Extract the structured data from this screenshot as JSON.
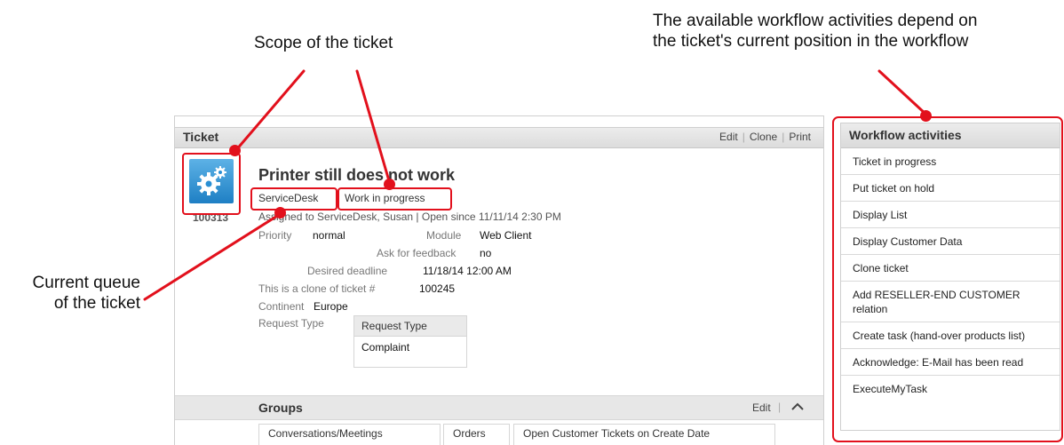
{
  "annotations": {
    "scope": "Scope of the ticket",
    "workflow_line1": "The available workflow activities depend on",
    "workflow_line2": "the ticket's current position in the workflow",
    "queue_line1": "Current queue",
    "queue_line2": "of the ticket"
  },
  "ticket": {
    "header_title": "Ticket",
    "actions": {
      "edit": "Edit",
      "clone": "Clone",
      "print": "Print"
    },
    "number": "100313",
    "title": "Printer still does not work",
    "queue": "ServiceDesk",
    "status": "Work in progress",
    "assigned": "Assigned to ServiceDesk, Susan | Open since 11/11/14 2:30 PM",
    "fields": {
      "priority_label": "Priority",
      "priority_value": "normal",
      "module_label": "Module",
      "module_value": "Web Client",
      "feedback_label": "Ask for feedback",
      "feedback_value": "no",
      "deadline_label": "Desired deadline",
      "deadline_value": "11/18/14 12:00 AM",
      "clone_label": "This is a clone of ticket #",
      "clone_value": "100245",
      "continent_label": "Continent",
      "continent_value": "Europe",
      "request_type_label": "Request Type"
    },
    "request_type_table": {
      "header": "Request Type",
      "value": "Complaint"
    },
    "icon": "gears-icon"
  },
  "groups": {
    "title": "Groups",
    "edit": "Edit",
    "tabs": [
      "Conversations/Meetings",
      "Orders",
      "Open Customer Tickets on Create Date"
    ]
  },
  "workflow": {
    "title": "Workflow activities",
    "items": [
      "Ticket in progress",
      "Put ticket on hold",
      "Display List",
      "Display Customer Data",
      "Clone ticket",
      "Add RESELLER-END CUSTOMER relation",
      "Create task (hand-over products list)",
      "Acknowledge: E-Mail has been read",
      "ExecuteMyTask"
    ]
  },
  "colors": {
    "annotation_red": "#e2101c",
    "icon_blue": "#2a8fd4"
  }
}
